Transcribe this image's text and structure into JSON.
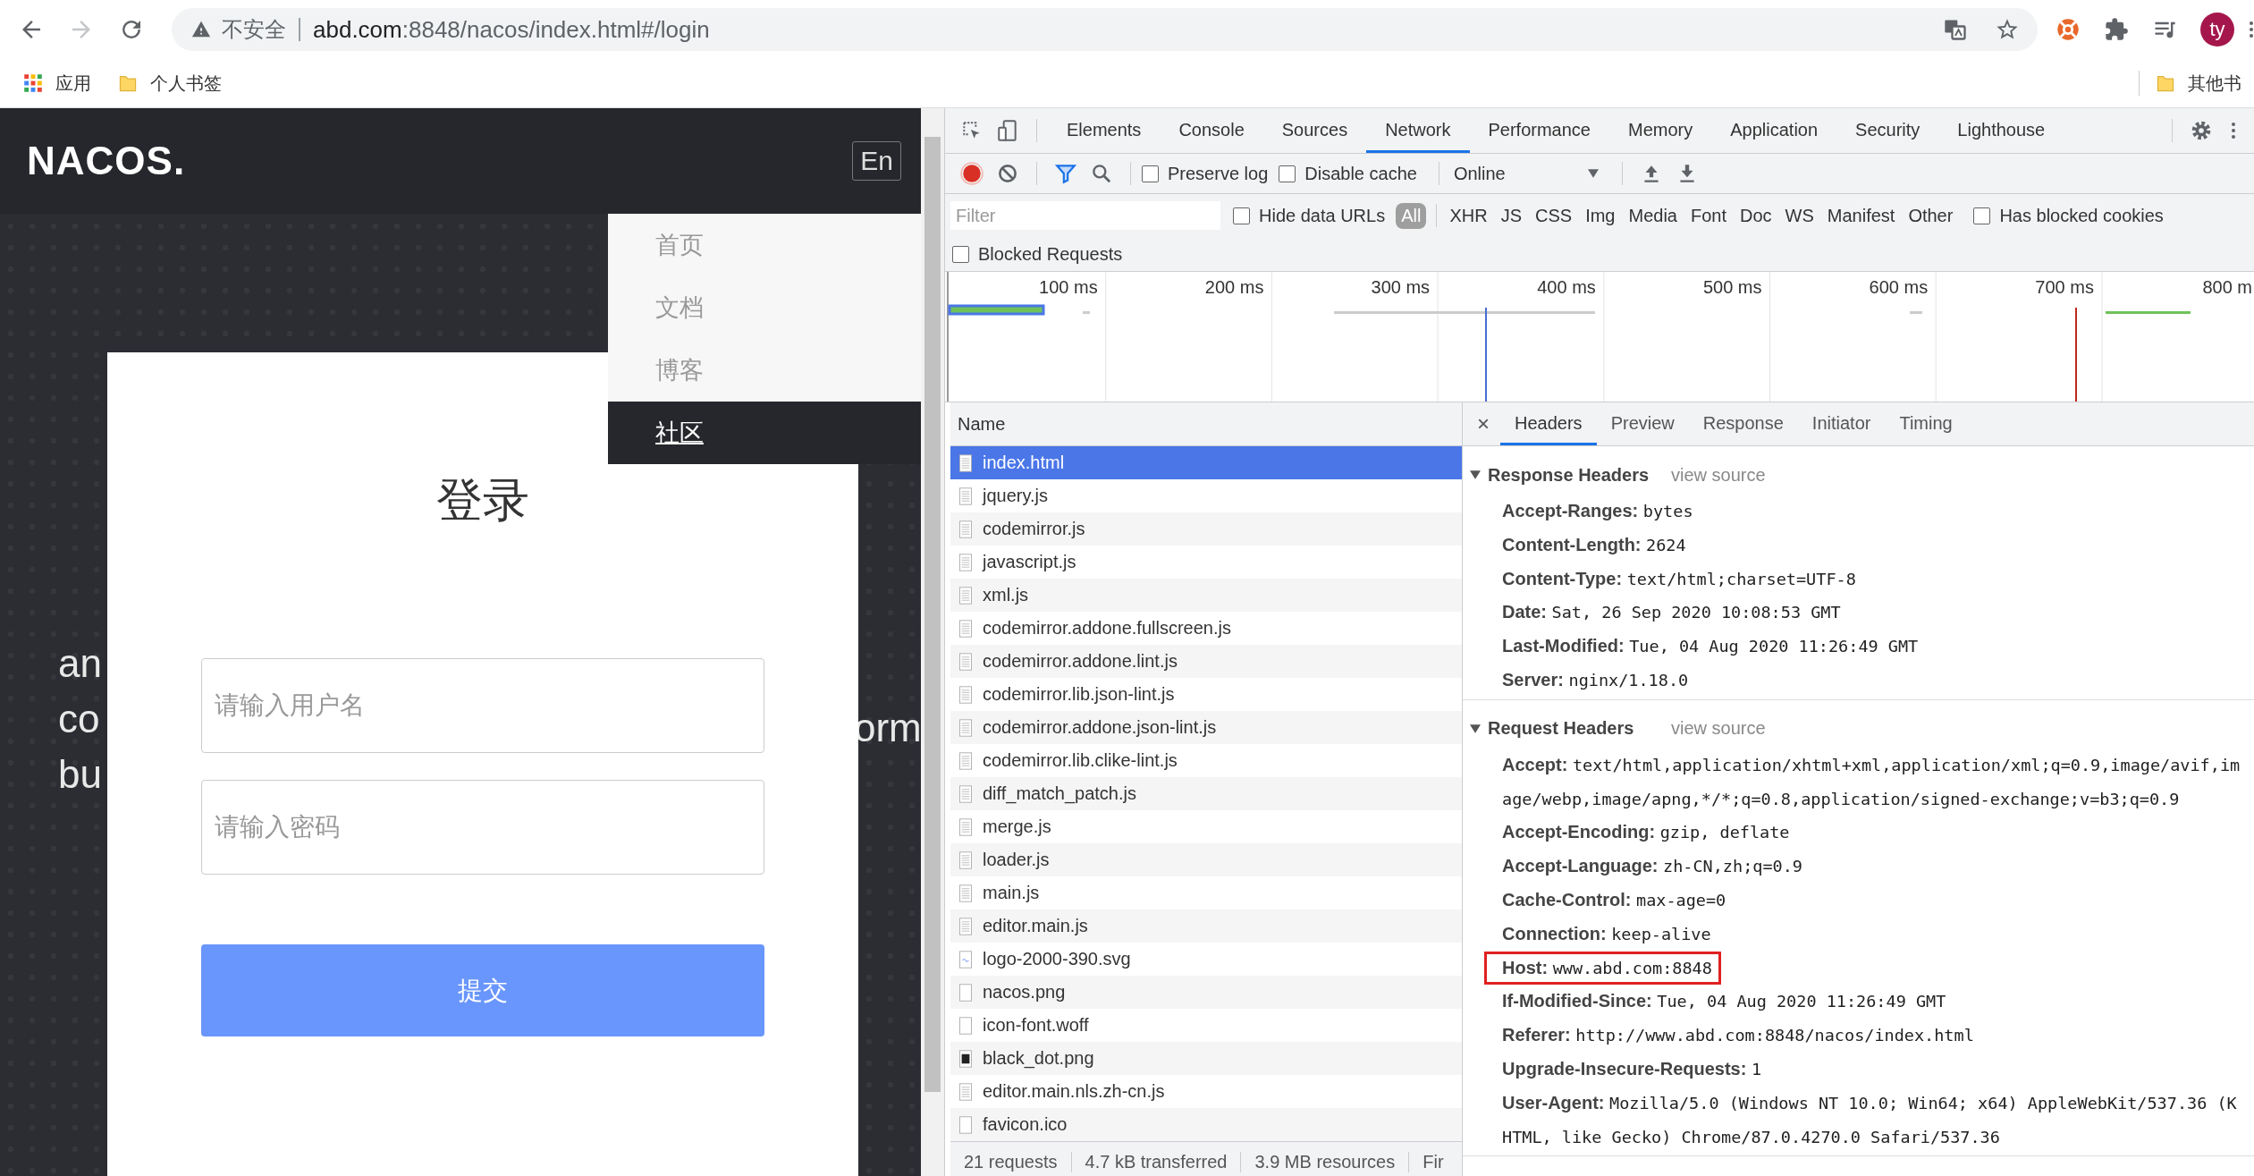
{
  "browser": {
    "nav_buttons": [
      {
        "kind": "back",
        "disabled": false
      },
      {
        "kind": "forward",
        "disabled": true
      },
      {
        "kind": "reload",
        "disabled": false
      }
    ],
    "security_label": "不安全",
    "url_host": "abd.com",
    "url_rest": ":8848/nacos/index.html#/login",
    "profile_initials": "ty",
    "bookmarks": [
      {
        "kind": "apps",
        "label": "应用"
      },
      {
        "kind": "folder",
        "label": "个人书签"
      }
    ],
    "other_bookmarks": "其他书"
  },
  "page": {
    "logo": "NACOS.",
    "lang_button": "En",
    "menu": [
      {
        "label": "首页",
        "selected": false
      },
      {
        "label": "文档",
        "selected": false
      },
      {
        "label": "博客",
        "selected": false
      },
      {
        "label": "社区",
        "selected": true
      }
    ],
    "hero_lines": [
      "an",
      "co",
      "bu"
    ],
    "hero_fragment": "orm",
    "login": {
      "title": "登录",
      "fields": [
        {
          "placeholder": "请输入用户名"
        },
        {
          "placeholder": "请输入密码"
        }
      ],
      "submit": "提交"
    }
  },
  "devtools": {
    "tabs": [
      {
        "label": "Elements",
        "selected": false
      },
      {
        "label": "Console",
        "selected": false
      },
      {
        "label": "Sources",
        "selected": false
      },
      {
        "label": "Network",
        "selected": true
      },
      {
        "label": "Performance",
        "selected": false
      },
      {
        "label": "Memory",
        "selected": false
      },
      {
        "label": "Application",
        "selected": false
      },
      {
        "label": "Security",
        "selected": false
      },
      {
        "label": "Lighthouse",
        "selected": false
      }
    ],
    "toolbar": {
      "recording": true,
      "filter_active": true,
      "preserve_log": {
        "label": "Preserve log",
        "checked": false
      },
      "disable_cache": {
        "label": "Disable cache",
        "checked": false
      },
      "throttling": "Online"
    },
    "filter": {
      "placeholder": "Filter",
      "hide_data_urls": {
        "label": "Hide data URLs",
        "checked": false
      },
      "types": [
        {
          "label": "All",
          "selected": true
        },
        {
          "label": "XHR",
          "selected": false
        },
        {
          "label": "JS",
          "selected": false
        },
        {
          "label": "CSS",
          "selected": false
        },
        {
          "label": "Img",
          "selected": false
        },
        {
          "label": "Media",
          "selected": false
        },
        {
          "label": "Font",
          "selected": false
        },
        {
          "label": "Doc",
          "selected": false
        },
        {
          "label": "WS",
          "selected": false
        },
        {
          "label": "Manifest",
          "selected": false
        },
        {
          "label": "Other",
          "selected": false
        }
      ],
      "has_blocked_cookies": {
        "label": "Has blocked cookies",
        "checked": false
      },
      "blocked_requests": {
        "label": "Blocked Requests",
        "checked": false
      }
    },
    "timeline_ticks": [
      "100 ms",
      "200 ms",
      "300 ms",
      "400 ms",
      "500 ms",
      "600 ms",
      "700 ms",
      "800 m"
    ],
    "requests": {
      "column": "Name",
      "rows": [
        {
          "name": "index.html",
          "kind": "document",
          "selected": true
        },
        {
          "name": "jquery.js",
          "kind": "script",
          "selected": false
        },
        {
          "name": "codemirror.js",
          "kind": "script",
          "selected": false
        },
        {
          "name": "javascript.js",
          "kind": "script",
          "selected": false
        },
        {
          "name": "xml.js",
          "kind": "script",
          "selected": false
        },
        {
          "name": "codemirror.addone.fullscreen.js",
          "kind": "script",
          "selected": false
        },
        {
          "name": "codemirror.addone.lint.js",
          "kind": "script",
          "selected": false
        },
        {
          "name": "codemirror.lib.json-lint.js",
          "kind": "script",
          "selected": false
        },
        {
          "name": "codemirror.addone.json-lint.js",
          "kind": "script",
          "selected": false
        },
        {
          "name": "codemirror.lib.clike-lint.js",
          "kind": "script",
          "selected": false
        },
        {
          "name": "diff_match_patch.js",
          "kind": "script",
          "selected": false
        },
        {
          "name": "merge.js",
          "kind": "script",
          "selected": false
        },
        {
          "name": "loader.js",
          "kind": "script",
          "selected": false
        },
        {
          "name": "main.js",
          "kind": "script",
          "selected": false
        },
        {
          "name": "editor.main.js",
          "kind": "script",
          "selected": false
        },
        {
          "name": "logo-2000-390.svg",
          "kind": "svg",
          "selected": false
        },
        {
          "name": "nacos.png",
          "kind": "blank",
          "selected": false
        },
        {
          "name": "icon-font.woff",
          "kind": "blank",
          "selected": false
        },
        {
          "name": "black_dot.png",
          "kind": "dark",
          "selected": false
        },
        {
          "name": "editor.main.nls.zh-cn.js",
          "kind": "script",
          "selected": false
        },
        {
          "name": "favicon.ico",
          "kind": "blank",
          "selected": false
        }
      ]
    },
    "summary": [
      "21 requests",
      "4.7 kB transferred",
      "3.9 MB resources",
      "Fir"
    ],
    "detail": {
      "close": "×",
      "tabs": [
        {
          "label": "Headers",
          "selected": true
        },
        {
          "label": "Preview",
          "selected": false
        },
        {
          "label": "Response",
          "selected": false
        },
        {
          "label": "Initiator",
          "selected": false
        },
        {
          "label": "Timing",
          "selected": false
        }
      ],
      "sections": [
        {
          "title": "Response Headers",
          "link": "view source",
          "expanded": true,
          "headers": [
            {
              "name": "Accept-Ranges:",
              "value": "bytes",
              "highlighted": false
            },
            {
              "name": "Content-Length:",
              "value": "2624",
              "highlighted": false
            },
            {
              "name": "Content-Type:",
              "value": "text/html;charset=UTF-8",
              "highlighted": false
            },
            {
              "name": "Date:",
              "value": "Sat, 26 Sep 2020 10:08:53 GMT",
              "highlighted": false
            },
            {
              "name": "Last-Modified:",
              "value": "Tue, 04 Aug 2020 11:26:49 GMT",
              "highlighted": false
            },
            {
              "name": "Server:",
              "value": "nginx/1.18.0",
              "highlighted": false
            }
          ]
        },
        {
          "title": "Request Headers",
          "link": "view source",
          "expanded": true,
          "headers": [
            {
              "name": "Accept:",
              "value": "text/html,application/xhtml+xml,application/xml;q=0.9,image/avif,image/webp,image/apng,*/*;q=0.8,application/signed-exchange;v=b3;q=0.9",
              "highlighted": false
            },
            {
              "name": "Accept-Encoding:",
              "value": "gzip, deflate",
              "highlighted": false
            },
            {
              "name": "Accept-Language:",
              "value": "zh-CN,zh;q=0.9",
              "highlighted": false
            },
            {
              "name": "Cache-Control:",
              "value": "max-age=0",
              "highlighted": false
            },
            {
              "name": "Connection:",
              "value": "keep-alive",
              "highlighted": false
            },
            {
              "name": "Host:",
              "value": "www.abd.com:8848",
              "highlighted": true
            },
            {
              "name": "If-Modified-Since:",
              "value": "Tue, 04 Aug 2020 11:26:49 GMT",
              "highlighted": false
            },
            {
              "name": "Referer:",
              "value": "http://www.abd.com:8848/nacos/index.html",
              "highlighted": false
            },
            {
              "name": "Upgrade-Insecure-Requests:",
              "value": "1",
              "highlighted": false
            },
            {
              "name": "User-Agent:",
              "value": "Mozilla/5.0 (Windows NT 10.0; Win64; x64) AppleWebKit/537.36 (KHTML, like Gecko) Chrome/87.0.4270.0 Safari/537.36",
              "highlighted": false
            }
          ]
        }
      ]
    }
  }
}
